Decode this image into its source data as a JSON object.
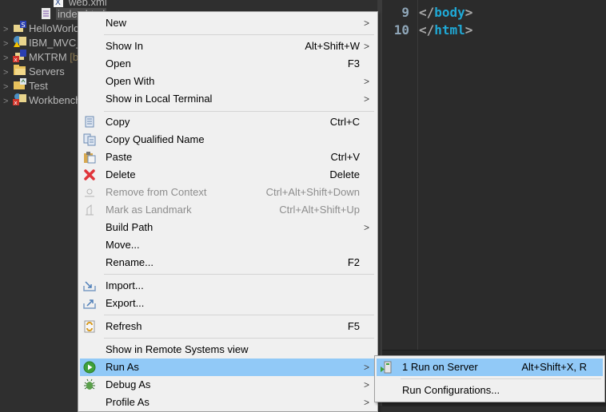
{
  "explorer": {
    "items": [
      {
        "label": "web.xml",
        "icon": "xml-file-icon",
        "twisty": ""
      },
      {
        "label": "index.html",
        "icon": "html-file-icon",
        "twisty": "",
        "selected": true
      },
      {
        "label": "HelloWorld",
        "icon": "java-project-icon",
        "twisty": ">"
      },
      {
        "label": "IBM_MVC_",
        "icon": "web-project-warning-icon",
        "twisty": ">"
      },
      {
        "label": "MKTRM",
        "suffix": " [b",
        "icon": "java-project-error-icon",
        "twisty": ">"
      },
      {
        "label": "Servers",
        "icon": "folder-icon",
        "twisty": ">"
      },
      {
        "label": "Test",
        "icon": "project-folder-icon",
        "twisty": ">"
      },
      {
        "label": "Workbench",
        "icon": "web-project-error-icon",
        "twisty": ">"
      }
    ]
  },
  "editor": {
    "lines": [
      {
        "number": "9",
        "open": "</",
        "tag": "body",
        "close": ">"
      },
      {
        "number": "10",
        "open": "</",
        "tag": "html",
        "close": ">"
      }
    ]
  },
  "context_menu": {
    "items": [
      {
        "label": "New",
        "accel": "",
        "submenu": true
      },
      {
        "label": "Show In",
        "accel": "Alt+Shift+W",
        "submenu": true
      },
      {
        "label": "Open",
        "accel": "F3"
      },
      {
        "label": "Open With",
        "accel": "",
        "submenu": true
      },
      {
        "label": "Show in Local Terminal",
        "accel": "",
        "submenu": true
      },
      {
        "label": "Copy",
        "accel": "Ctrl+C",
        "icon": "copy-icon"
      },
      {
        "label": "Copy Qualified Name",
        "accel": "",
        "icon": "copy-qualified-name-icon"
      },
      {
        "label": "Paste",
        "accel": "Ctrl+V",
        "icon": "paste-icon"
      },
      {
        "label": "Delete",
        "accel": "Delete",
        "icon": "delete-icon"
      },
      {
        "label": "Remove from Context",
        "accel": "Ctrl+Alt+Shift+Down",
        "icon": "remove-context-icon",
        "disabled": true
      },
      {
        "label": "Mark as Landmark",
        "accel": "Ctrl+Alt+Shift+Up",
        "icon": "landmark-icon",
        "disabled": true
      },
      {
        "label": "Build Path",
        "accel": "",
        "submenu": true
      },
      {
        "label": "Move...",
        "accel": ""
      },
      {
        "label": "Rename...",
        "accel": "F2"
      },
      {
        "label": "Import...",
        "accel": "",
        "icon": "import-icon"
      },
      {
        "label": "Export...",
        "accel": "",
        "icon": "export-icon"
      },
      {
        "label": "Refresh",
        "accel": "F5",
        "icon": "refresh-icon"
      },
      {
        "label": "Show in Remote Systems view",
        "accel": ""
      },
      {
        "label": "Run As",
        "accel": "",
        "submenu": true,
        "icon": "run-icon",
        "highlighted": true
      },
      {
        "label": "Debug As",
        "accel": "",
        "submenu": true,
        "icon": "debug-icon"
      },
      {
        "label": "Profile As",
        "accel": "",
        "submenu": true
      }
    ],
    "arrow": ">"
  },
  "run_as_submenu": {
    "items": [
      {
        "label": "1 Run on Server",
        "accel": "Alt+Shift+X, R",
        "icon": "run-on-server-icon",
        "highlighted": true
      },
      {
        "label": "Run Configurations...",
        "accel": ""
      }
    ]
  },
  "colors": {
    "highlight": "#91c9f7",
    "editor_tag": "#1fa9d6",
    "background": "#2f2f2f"
  }
}
